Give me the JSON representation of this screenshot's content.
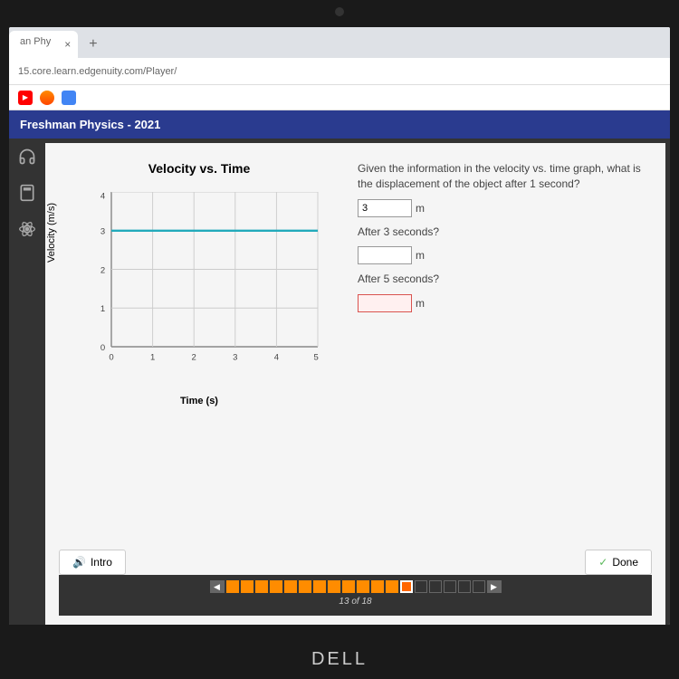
{
  "browser": {
    "tab_title": "an Phy",
    "new_tab": "+",
    "url": "15.core.learn.edgenuity.com/Player/"
  },
  "course": {
    "title": "Freshman Physics - 2021"
  },
  "chart_data": {
    "type": "line",
    "title": "Velocity vs. Time",
    "xlabel": "Time (s)",
    "ylabel": "Velocity (m/s)",
    "x": [
      0,
      1,
      2,
      3,
      4,
      5
    ],
    "y": [
      3,
      3,
      3,
      3,
      3,
      3
    ],
    "xlim": [
      0,
      5
    ],
    "ylim": [
      0,
      4
    ],
    "xticks": [
      0,
      1,
      2,
      3,
      4,
      5
    ],
    "yticks": [
      0,
      1,
      2,
      3,
      4
    ]
  },
  "question": {
    "prompt": "Given the information in the velocity vs. time graph, what is the displacement of the object after 1 second?",
    "q1_value": "3",
    "unit": "m",
    "q2_label": "After 3 seconds?",
    "q2_value": "",
    "q3_label": "After 5 seconds?",
    "q3_value": ""
  },
  "controls": {
    "intro": "Intro",
    "done": "Done"
  },
  "progress": {
    "text": "13 of 18"
  },
  "brand": "DELL"
}
